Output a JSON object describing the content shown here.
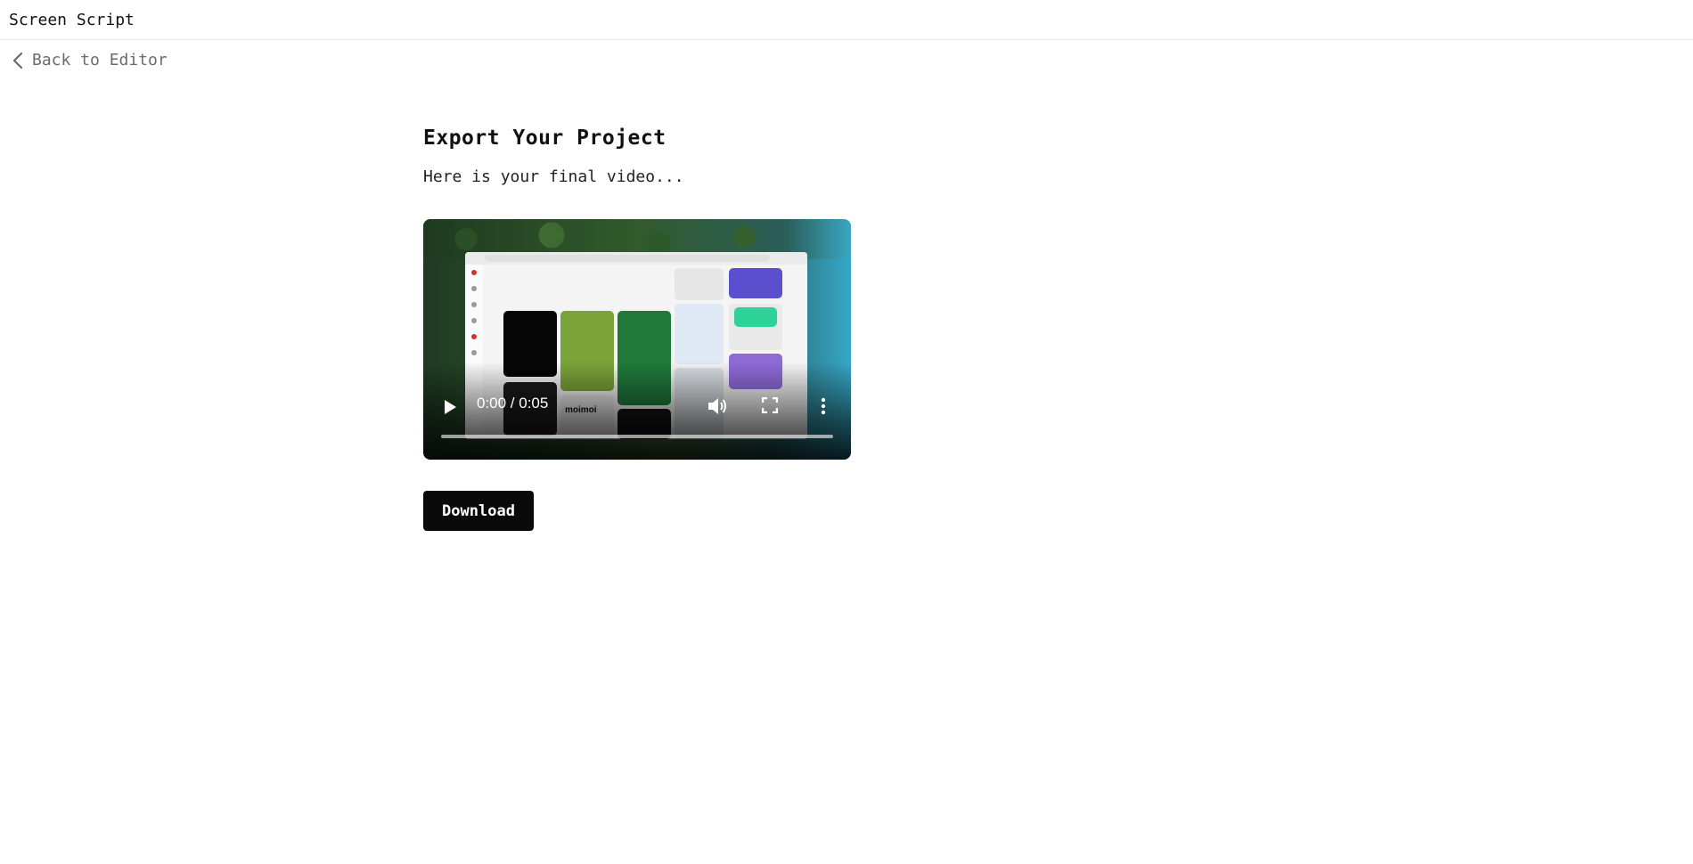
{
  "app": {
    "title": "Screen Script"
  },
  "nav": {
    "back_label": "Back to Editor"
  },
  "main": {
    "title": "Export Your Project",
    "subtitle": "Here is your final video..."
  },
  "video": {
    "current_time": "0:00",
    "duration": "0:05",
    "time_display": "0:00 / 0:05",
    "progress": 0
  },
  "actions": {
    "download_label": "Download"
  },
  "icons": [
    "chevron-left-icon",
    "play-icon",
    "volume-icon",
    "fullscreen-icon",
    "more-vert-icon"
  ]
}
